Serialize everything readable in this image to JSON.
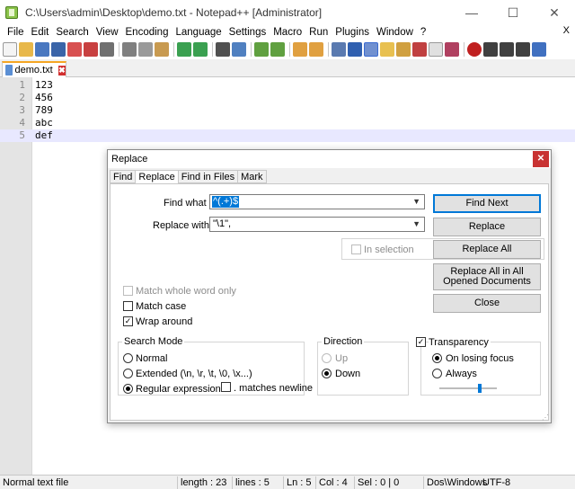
{
  "window": {
    "title": "C:\\Users\\admin\\Desktop\\demo.txt - Notepad++ [Administrator]",
    "minimize": "—",
    "maximize": "☐",
    "close": "✕"
  },
  "menu": {
    "items": [
      "File",
      "Edit",
      "Search",
      "View",
      "Encoding",
      "Language",
      "Settings",
      "Macro",
      "Run",
      "Plugins",
      "Window",
      "?"
    ],
    "close": "X"
  },
  "tabs": [
    {
      "label": "demo.txt",
      "close": "✖"
    }
  ],
  "editor": {
    "lines": [
      {
        "num": "1",
        "text": "123"
      },
      {
        "num": "2",
        "text": "456"
      },
      {
        "num": "3",
        "text": "789"
      },
      {
        "num": "4",
        "text": "abc"
      },
      {
        "num": "5",
        "text": "def"
      }
    ]
  },
  "status": {
    "type": "Normal text file",
    "length": "length : 23",
    "lines": "lines : 5",
    "ln": "Ln : 5",
    "col": "Col : 4",
    "sel": "Sel : 0 | 0",
    "eol": "Dos\\Windows",
    "encoding": "UTF-8"
  },
  "dialog": {
    "title": "Replace",
    "close": "✕",
    "tabs": [
      "Find",
      "Replace",
      "Find in Files",
      "Mark"
    ],
    "find_label": "Find what :",
    "find_value": "^(.+)$",
    "replace_label": "Replace with :",
    "replace_value": "\"\\1\",",
    "in_selection": "In selection",
    "buttons": {
      "find_next": "Find Next",
      "replace": "Replace",
      "replace_all": "Replace All",
      "replace_all_opened": "Replace All in All Opened Documents",
      "close": "Close"
    },
    "match_whole_word": "Match whole word only",
    "match_case": "Match case",
    "wrap_around": "Wrap around",
    "search_mode": {
      "title": "Search Mode",
      "normal": "Normal",
      "extended": "Extended (\\n, \\r, \\t, \\0, \\x...)",
      "regex": "Regular expression",
      "matches_newline": ". matches newline"
    },
    "direction": {
      "title": "Direction",
      "up": "Up",
      "down": "Down"
    },
    "transparency": {
      "title": "Transparency",
      "on_losing_focus": "On losing focus",
      "always": "Always",
      "level": 0.7
    }
  }
}
